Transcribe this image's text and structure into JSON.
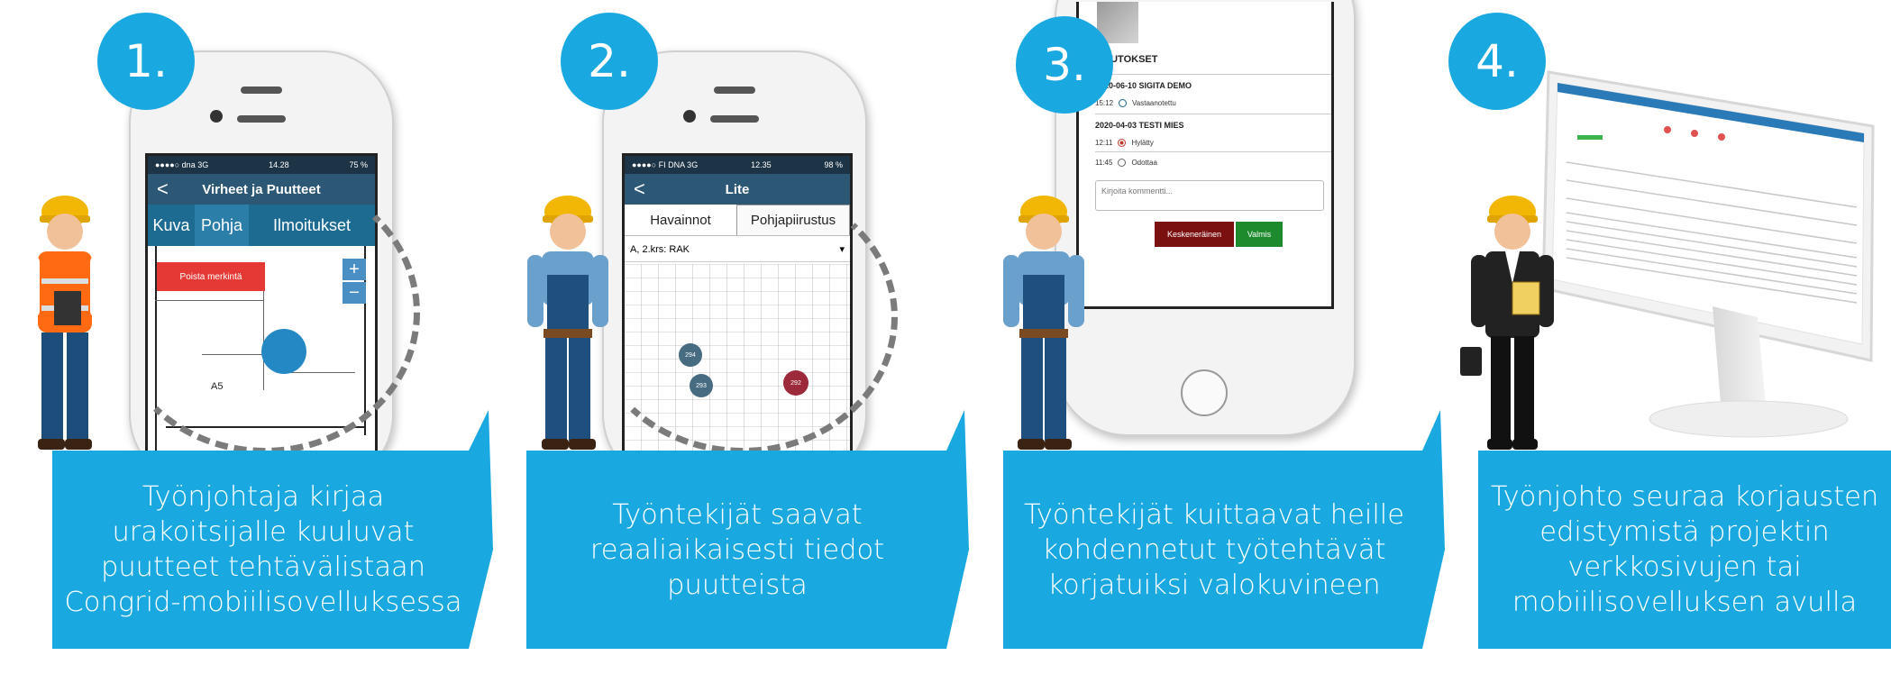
{
  "steps": [
    {
      "number": "1.",
      "caption_lines": [
        "Työnjohtaja kirjaa",
        "urakoitsijalle kuuluvat",
        "puutteet tehtävälistaan",
        "Congrid-mobiilisovelluksessa"
      ],
      "phone": {
        "status_left": "●●●●○ dna  3G",
        "status_time": "14.28",
        "status_right": "75 %",
        "back": "<",
        "title": "Virheet ja Puutteet",
        "tabs": [
          "Kuva",
          "Pohja",
          "Ilmoitukset"
        ],
        "delete_button": "Poista merkintä",
        "room_label": "A5",
        "zoom_in": "+",
        "zoom_out": "−"
      }
    },
    {
      "number": "2.",
      "caption_lines": [
        "Työntekijät saavat",
        "reaaliaikaisesti tiedot",
        "puutteista"
      ],
      "phone": {
        "status_left": "●●●●○ FI DNA  3G",
        "status_time": "12.35",
        "status_right": "98 %",
        "back": "<",
        "title": "Lite",
        "tabs": [
          "Havainnot",
          "Pohjapiirustus"
        ],
        "dropdown": "A, 2.krs: RAK",
        "markers": [
          "294",
          "293",
          "292"
        ]
      }
    },
    {
      "number": "3.",
      "caption_lines": [
        "Työntekijät kuittaavat heille",
        "kohdennetut työtehtävät",
        "korjatuiksi valokuvineen"
      ],
      "phone": {
        "section_title": "MUUTOKSET",
        "entries": [
          {
            "header": "2020-06-10 SIGITA DEMO",
            "time": "15:12",
            "status": "Vastaanotettu"
          },
          {
            "header": "2020-04-03 TESTI MIES",
            "time": "12:11",
            "status": "Hylätty"
          },
          {
            "header": "",
            "time": "11:45",
            "status": "Odottaa"
          }
        ],
        "comment_placeholder": "Kirjoita kommentti...",
        "btn_unfinished": "Keskeneräinen",
        "btn_done": "Valmis"
      }
    },
    {
      "number": "4.",
      "caption_lines": [
        "Työnjohto seuraa korjausten",
        "edistymistä projektin",
        "verkkosivujen tai",
        "mobiilisovelluksen avulla"
      ]
    }
  ],
  "colors": {
    "accent": "#1aa8e0",
    "phone_header": "#2d5875",
    "tab_bar": "#2b7ea8",
    "delete_red": "#e53935",
    "btn_unfinished": "#7a1010",
    "btn_done": "#1e8a2e"
  }
}
